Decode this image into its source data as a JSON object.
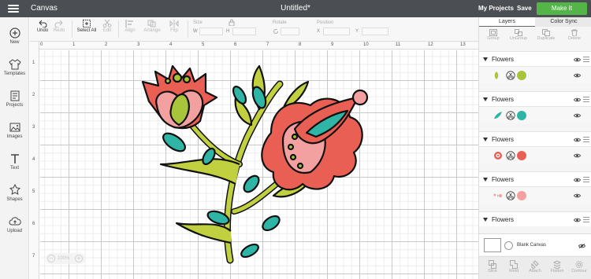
{
  "topbar": {
    "app_title": "Canvas",
    "doc_title": "Untitled*",
    "my_projects": "My Projects",
    "save": "Save",
    "make_it": "Make It",
    "make_color": "#53b447"
  },
  "sidebar": [
    {
      "label": "New",
      "icon": "plus-circle-icon"
    },
    {
      "label": "Templates",
      "icon": "shirt-icon"
    },
    {
      "label": "Projects",
      "icon": "projects-icon"
    },
    {
      "label": "Images",
      "icon": "image-icon"
    },
    {
      "label": "Text",
      "icon": "text-icon"
    },
    {
      "label": "Shapes",
      "icon": "shapes-icon"
    },
    {
      "label": "Upload",
      "icon": "upload-cloud-icon"
    }
  ],
  "toolbar": {
    "undo": "Undo",
    "redo": "Redo",
    "select_all": "Select All",
    "edit": "Edit",
    "align": "Align",
    "arrange": "Arrange",
    "flip": "Flip",
    "size": "Size",
    "w": "W",
    "h": "H",
    "rotate": "Rotate",
    "position": "Position",
    "x": "X",
    "y": "Y"
  },
  "ruler": {
    "top": [
      "0",
      "1",
      "2",
      "3",
      "4",
      "5",
      "6",
      "7",
      "8",
      "9",
      "10",
      "11",
      "12",
      "13"
    ],
    "left": [
      "1",
      "2",
      "3",
      "4",
      "5",
      "6",
      "7"
    ]
  },
  "canvas": {
    "zoom": "100%"
  },
  "panel": {
    "tabs": [
      "Layers",
      "Color Sync"
    ],
    "layer_tools": [
      "Group",
      "UnGroup",
      "Duplicate",
      "Delete"
    ],
    "layers": [
      {
        "name": "Flowers",
        "color": "#a8c43a",
        "icon": "leaf-icon"
      },
      {
        "name": "Flowers",
        "color": "#2fb5a5",
        "icon": "leaf-teal-icon"
      },
      {
        "name": "Flowers",
        "color": "#ea5f54",
        "icon": "flower-red-icon"
      },
      {
        "name": "Flowers",
        "color": "#f3a0a0",
        "icon": "pink-shapes-icon"
      },
      {
        "name": "Flowers",
        "color": "",
        "icon": ""
      }
    ],
    "blank_canvas": "Blank Canvas",
    "bottom_tools": [
      "Slice",
      "Weld",
      "Attach",
      "Flatten",
      "Contour"
    ]
  }
}
